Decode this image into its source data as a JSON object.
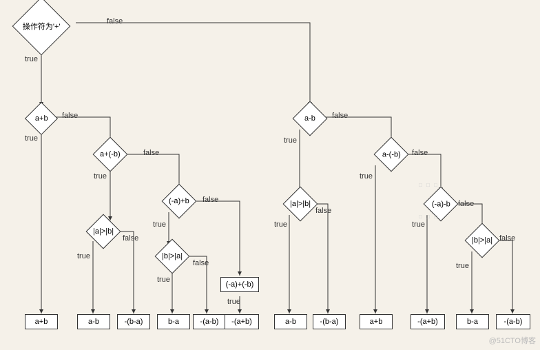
{
  "diagram": {
    "type": "flowchart",
    "description": "Decision tree for arithmetic operation based on operator being '+' or not, with nested sign/magnitude cases",
    "decisions": {
      "root": "操作符为'+'",
      "aplusb": "a+b",
      "aplus_negb": "a+(-b)",
      "nega_plusb": "(-a)+b",
      "abs_a_gt_b_1": "|a|>|b|",
      "abs_b_gt_a_1": "|b|>|a|",
      "nega_plus_negb": "(-a)+(-b)",
      "aminusb": "a-b",
      "a_minus_negb": "a-(-b)",
      "abs_a_gt_b_2": "|a|>|b|",
      "nega_minus_b": "(-a)-b",
      "abs_b_gt_a_2": "|b|>|a|"
    },
    "results": {
      "r1": "a+b",
      "r2": "a-b",
      "r3": "-(b-a)",
      "r4": "b-a",
      "r5": "-(a-b)",
      "r6": "-(a+b)",
      "r7": "a-b",
      "r8": "-(b-a)",
      "r9": "a+b",
      "r10": "-(a+b)",
      "r11": "b-a",
      "r12": "-(a-b)"
    },
    "labels": {
      "true": "true",
      "false": "false"
    }
  },
  "watermark": "@51CTO博客"
}
